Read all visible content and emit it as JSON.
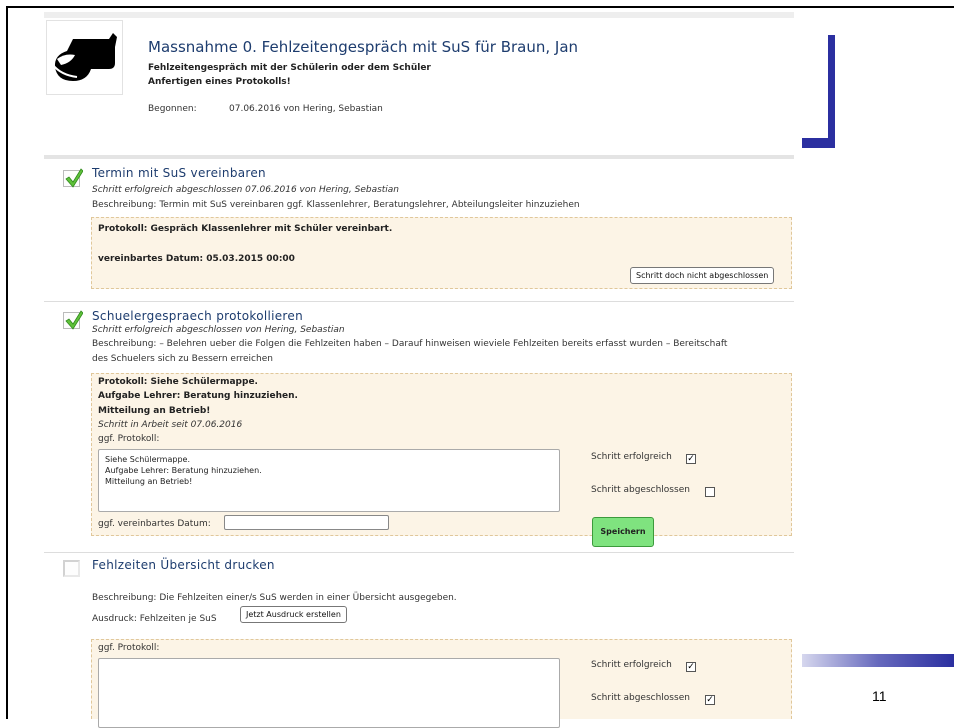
{
  "header": {
    "title": "Massnahme 0. Fehlzeitengespräch mit SuS für Braun, Jan",
    "subtitle_line1": "Fehlzeitengespräch mit der Schülerin oder dem Schüler",
    "subtitle_line2": "Anfertigen eines Protokolls!",
    "started_label": "Begonnen:",
    "started_value": "07.06.2016 von Hering, Sebastian"
  },
  "steps": [
    {
      "title": "Termin mit SuS vereinbaren",
      "status": "Schritt erfolgreich abgeschlossen 07.06.2016 von Hering, Sebastian",
      "description": "Beschreibung: Termin mit SuS vereinbaren ggf. Klassenlehrer, Beratungslehrer, Abteilungsleiter hinzuziehen",
      "protocol": "Protokoll: Gespräch Klassenlehrer mit Schüler vereinbart.",
      "agreed_date": "vereinbartes Datum: 05.03.2015 00:00",
      "undo_button": "Schritt doch nicht abgeschlossen",
      "done": true
    },
    {
      "title": "Schuelergespraech protokollieren",
      "status": "Schritt erfolgreich abgeschlossen von Hering, Sebastian",
      "description_line1": "Beschreibung: – Belehren ueber die Folgen die Fehlzeiten haben – Darauf hinweisen wieviele Fehlzeiten bereits erfasst wurden – Bereitschaft",
      "description_line2": "des Schuelers sich zu Bessern erreichen",
      "protocol_line1": "Protokoll: Siehe Schülermappe.",
      "protocol_line2": "Aufgabe Lehrer: Beratung hinzuziehen.",
      "protocol_line3": "Mitteilung an Betrieb!",
      "in_progress": "Schritt in Arbeit seit 07.06.2016",
      "protocol_label": "ggf. Protokoll:",
      "textarea_line1": "Siehe Schülermappe.",
      "textarea_line2": "Aufgabe Lehrer: Beratung hinzuziehen.",
      "textarea_line3": "Mitteilung an Betrieb!",
      "date_label": "ggf. vereinbartes Datum:",
      "date_value": "",
      "success_label": "Schritt erfolgreich",
      "success_checked": true,
      "closed_label": "Schritt abgeschlossen",
      "closed_checked": false,
      "save_button": "Speichern",
      "done": true
    },
    {
      "title": "Fehlzeiten Übersicht drucken",
      "description": "Beschreibung: Die Fehlzeiten einer/s SuS werden in einer Übersicht ausgegeben.",
      "print_label": "Ausdruck: Fehlzeiten je SuS",
      "print_button": "Jetzt Ausdruck erstellen",
      "protocol_label": "ggf. Protokoll:",
      "success_label": "Schritt erfolgreich",
      "success_checked": true,
      "closed_label": "Schritt abgeschlossen",
      "closed_checked": true,
      "done": false
    }
  ],
  "slide_number": "11",
  "colors": {
    "accent_blue": "#2b2fa0",
    "title_blue": "#1d3c6e",
    "protocol_bg": "#fcf4e6",
    "save_green": "#7fe37f"
  }
}
